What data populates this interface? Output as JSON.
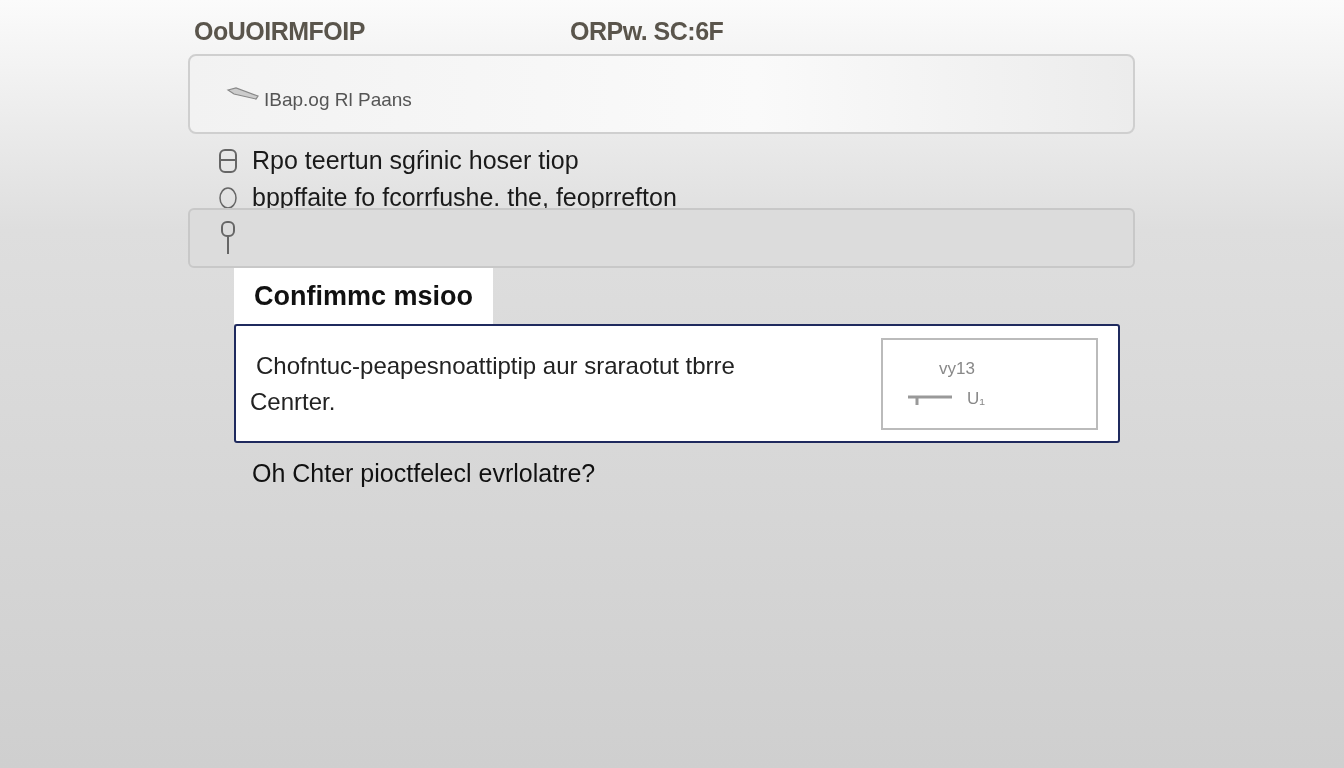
{
  "header": {
    "left_label": "OoUOIRMFOIP",
    "right_label": "ORPw. SC:6F"
  },
  "search": {
    "value": "IBap.og Rl Paans"
  },
  "lines": [
    {
      "text": "Rpo teertun sgŕinic hoser tiop"
    },
    {
      "text": "bppffaite fo fcorrfushe. the, feoprrefton"
    }
  ],
  "tab": {
    "label": "Confimmc msioo",
    "selected": true
  },
  "dialog": {
    "message": "Chofntuc-peapesnoattiptip aur sraraotut tbrre",
    "message_2": "Cenrter.",
    "box_top": "vy13",
    "box_bottom": "U₁"
  },
  "question": "Oh Chter pioctfelecl evrlolatre?"
}
